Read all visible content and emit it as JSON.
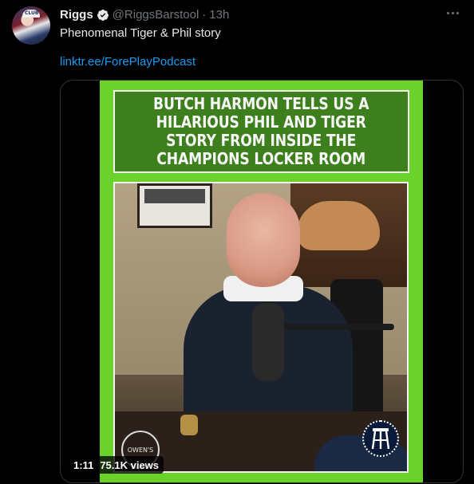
{
  "tweet": {
    "author_name": "Riggs",
    "handle": "@RiggsBarstool",
    "separator": "·",
    "time": "13h",
    "text": "Phenomenal Tiger & Phil story",
    "link": "linktr.ee/ForePlayPodcast",
    "avatar_cap_text": "CLUB"
  },
  "media": {
    "banner_text": "BUTCH HARMON TELLS US A\nHILARIOUS PHIL AND TIGER\nSTORY FROM INSIDE THE\nCHAMPIONS LOCKER ROOM",
    "badge_left_text": "OWEN'S",
    "duration": "1:11",
    "views": "75.1K views",
    "frame_color": "#6bd22c",
    "banner_color": "#3d7f1c"
  },
  "icons": {
    "verified": "verified-badge-icon",
    "more": "more-icon",
    "barstool": "barstool-logo-icon"
  },
  "colors": {
    "background": "#000000",
    "text": "#e7e9ea",
    "muted": "#71767b",
    "link": "#1d9bf0"
  }
}
